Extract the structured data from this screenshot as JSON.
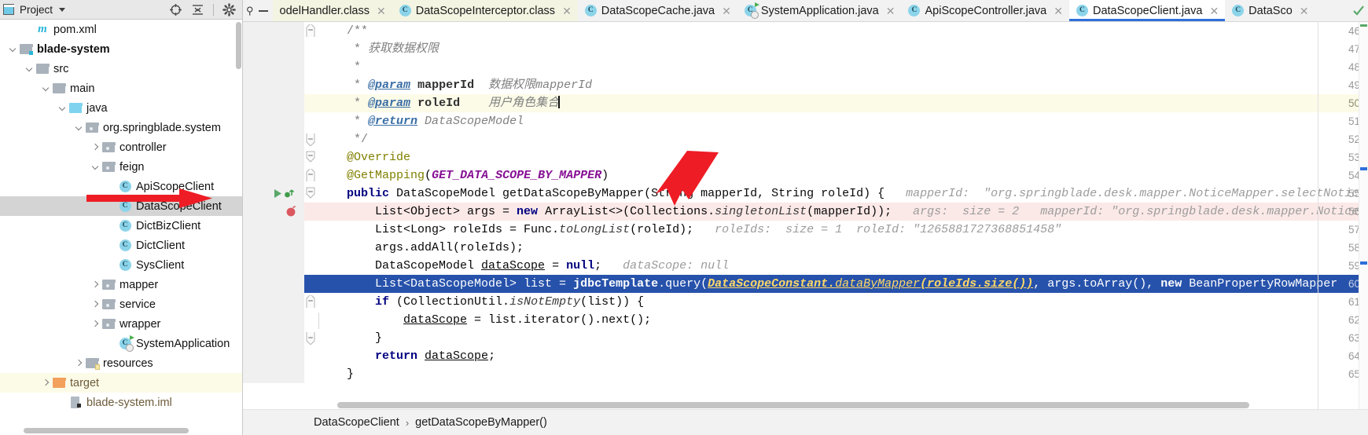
{
  "project_panel": {
    "title": "Project",
    "title_caret": "▾",
    "icons": [
      {
        "name": "locate-icon"
      },
      {
        "name": "collapse-all-icon"
      },
      {
        "name": "gear-icon"
      }
    ],
    "tree": [
      {
        "label": "pom.xml",
        "indent": 1,
        "twist": "",
        "icon": "maven-file-icon",
        "style": "plain",
        "row": "plain"
      },
      {
        "label": "blade-system",
        "indent": 0,
        "twist": "down",
        "icon": "module-folder-icon",
        "style": "bold",
        "row": "plain"
      },
      {
        "label": "src",
        "indent": 1,
        "twist": "down",
        "icon": "folder-icon",
        "style": "plain",
        "row": "plain"
      },
      {
        "label": "main",
        "indent": 2,
        "twist": "down",
        "icon": "folder-icon",
        "style": "plain",
        "row": "plain"
      },
      {
        "label": "java",
        "indent": 3,
        "twist": "down",
        "icon": "source-root-icon",
        "style": "plain",
        "row": "plain"
      },
      {
        "label": "org.springblade.system",
        "indent": 4,
        "twist": "down",
        "icon": "package-icon",
        "style": "plain",
        "row": "plain"
      },
      {
        "label": "controller",
        "indent": 5,
        "twist": "right",
        "icon": "package-icon",
        "style": "plain",
        "row": "plain"
      },
      {
        "label": "feign",
        "indent": 5,
        "twist": "down",
        "icon": "package-icon",
        "style": "plain",
        "row": "plain"
      },
      {
        "label": "ApiScopeClient",
        "indent": 6,
        "twist": "",
        "icon": "java-class-icon",
        "style": "plain",
        "row": "plain"
      },
      {
        "label": "DataScopeClient",
        "indent": 6,
        "twist": "",
        "icon": "java-class-icon",
        "style": "plain",
        "row": "selected"
      },
      {
        "label": "DictBizClient",
        "indent": 6,
        "twist": "",
        "icon": "java-class-icon",
        "style": "plain",
        "row": "plain"
      },
      {
        "label": "DictClient",
        "indent": 6,
        "twist": "",
        "icon": "java-class-icon",
        "style": "plain",
        "row": "plain"
      },
      {
        "label": "SysClient",
        "indent": 6,
        "twist": "",
        "icon": "java-class-icon",
        "style": "plain",
        "row": "plain"
      },
      {
        "label": "mapper",
        "indent": 5,
        "twist": "right",
        "icon": "package-icon",
        "style": "plain",
        "row": "plain"
      },
      {
        "label": "service",
        "indent": 5,
        "twist": "right",
        "icon": "package-icon",
        "style": "plain",
        "row": "plain"
      },
      {
        "label": "wrapper",
        "indent": 5,
        "twist": "right",
        "icon": "package-icon",
        "style": "plain",
        "row": "plain"
      },
      {
        "label": "SystemApplication",
        "indent": 6,
        "twist": "",
        "icon": "spring-boot-class-icon",
        "style": "plain",
        "row": "plain"
      },
      {
        "label": "resources",
        "indent": 4,
        "twist": "right",
        "icon": "resources-folder-icon",
        "style": "plain",
        "row": "plain"
      },
      {
        "label": "target",
        "indent": 2,
        "twist": "right",
        "icon": "target-folder-icon",
        "style": "brown",
        "row": "yellow"
      },
      {
        "label": "blade-system.iml",
        "indent": 3,
        "twist": "",
        "icon": "iml-file-icon",
        "style": "brown",
        "row": "plain"
      }
    ]
  },
  "editor_tabs": {
    "leading": {
      "pin_icon": "pin-icon",
      "dash_icon": "minimize-icon"
    },
    "tabs": [
      {
        "label": "odelHandler.class",
        "icon": "",
        "yellowed": true,
        "active": false,
        "clipped": true
      },
      {
        "label": "DataScopeInterceptor.class",
        "icon": "java-class-icon",
        "yellowed": true,
        "active": false,
        "clipped": false
      },
      {
        "label": "DataScopeCache.java",
        "icon": "java-class-icon",
        "yellowed": false,
        "active": false,
        "clipped": false
      },
      {
        "label": "SystemApplication.java",
        "icon": "spring-boot-class-icon",
        "yellowed": false,
        "active": false,
        "clipped": false
      },
      {
        "label": "ApiScopeController.java",
        "icon": "java-class-icon",
        "yellowed": false,
        "active": false,
        "clipped": false
      },
      {
        "label": "DataScopeClient.java",
        "icon": "java-class-icon",
        "yellowed": false,
        "active": true,
        "clipped": false
      },
      {
        "label": "DataSco",
        "icon": "java-class-icon",
        "yellowed": false,
        "active": false,
        "clipped": true
      }
    ],
    "close_glyph": "✕"
  },
  "code": {
    "first_line_number": 46,
    "lines": [
      {
        "num": "46",
        "row": "plain",
        "fold": "fold-end-top",
        "indent": 4,
        "tokens": [
          {
            "t": "/**",
            "c": "c-cmt-b"
          }
        ]
      },
      {
        "num": "47",
        "row": "plain",
        "fold": "",
        "indent": 5,
        "tokens": [
          {
            "t": "* ",
            "c": "c-cmt-b"
          },
          {
            "t": "获取数据权限",
            "c": "c-cmt"
          }
        ]
      },
      {
        "num": "48",
        "row": "plain",
        "fold": "",
        "indent": 5,
        "tokens": [
          {
            "t": "*",
            "c": "c-cmt-b"
          }
        ]
      },
      {
        "num": "49",
        "row": "plain",
        "fold": "",
        "indent": 5,
        "tokens": [
          {
            "t": "* ",
            "c": "c-cmt-b"
          },
          {
            "t": "@param",
            "c": "c-tag"
          },
          {
            "t": " ",
            "c": "c-cmt-b"
          },
          {
            "t": "mapperId",
            "c": "c-tagparam"
          },
          {
            "t": "  数据权限mapperId",
            "c": "c-cmt"
          }
        ]
      },
      {
        "num": "50",
        "row": "yellow",
        "fold": "",
        "indent": 5,
        "tokens": [
          {
            "t": "* ",
            "c": "c-cmt-b"
          },
          {
            "t": "@param",
            "c": "c-tag"
          },
          {
            "t": " ",
            "c": "c-cmt-b"
          },
          {
            "t": "roleId",
            "c": "c-tagparam"
          },
          {
            "t": "    用户角色集合",
            "c": "c-cmt"
          },
          {
            "t": "|caret|",
            "c": "caret"
          }
        ]
      },
      {
        "num": "51",
        "row": "plain",
        "fold": "",
        "indent": 5,
        "tokens": [
          {
            "t": "* ",
            "c": "c-cmt-b"
          },
          {
            "t": "@return",
            "c": "c-tag"
          },
          {
            "t": " DataScopeModel",
            "c": "c-cmt"
          }
        ]
      },
      {
        "num": "52",
        "row": "plain",
        "fold": "fold-end-bot",
        "indent": 5,
        "tokens": [
          {
            "t": "*/",
            "c": "c-cmt-b"
          }
        ]
      },
      {
        "num": "53",
        "row": "plain",
        "fold": "fold-collapse",
        "indent": 4,
        "tokens": [
          {
            "t": "@Override",
            "c": "c-anno"
          }
        ]
      },
      {
        "num": "54",
        "row": "plain",
        "fold": "fold-end-top",
        "indent": 4,
        "tokens": [
          {
            "t": "@GetMapping",
            "c": "c-anno"
          },
          {
            "t": "(",
            "c": "c-plain"
          },
          {
            "t": "GET_DATA_SCOPE_BY_MAPPER",
            "c": "c-const"
          },
          {
            "t": ")",
            "c": "c-plain"
          }
        ]
      },
      {
        "num": "55",
        "row": "plain",
        "fold": "fold-collapse",
        "indent": 4,
        "marker": "run-marker",
        "tokens": [
          {
            "t": "public",
            "c": "c-kw"
          },
          {
            "t": " DataScopeModel getDataScopeByMapper(String mapperId, String roleId) {",
            "c": "c-plain"
          },
          {
            "t": "   mapperId:  \"org.springblade.desk.mapper.NoticeMapper.selectNotic",
            "c": "c-hint"
          }
        ]
      },
      {
        "num": "56",
        "row": "pink",
        "fold": "",
        "indent": 8,
        "marker": "bp-marker",
        "tokens": [
          {
            "t": "List<Object> args = ",
            "c": "c-plain"
          },
          {
            "t": "new",
            "c": "c-kw"
          },
          {
            "t": " ArrayList<>(Collections.",
            "c": "c-plain"
          },
          {
            "t": "singletonList",
            "c": "c-static"
          },
          {
            "t": "(mapperId));",
            "c": "c-plain"
          },
          {
            "t": "   args:  size = 2   mapperId: \"org.springblade.desk.mapper.Notice",
            "c": "c-hint"
          }
        ]
      },
      {
        "num": "57",
        "row": "plain",
        "fold": "",
        "indent": 8,
        "tokens": [
          {
            "t": "List<Long> roleIds = Func.",
            "c": "c-plain"
          },
          {
            "t": "toLongList",
            "c": "c-static"
          },
          {
            "t": "(roleId);",
            "c": "c-plain"
          },
          {
            "t": "   roleIds:  size = 1  roleId: \"1265881727368851458\"",
            "c": "c-hint"
          }
        ]
      },
      {
        "num": "58",
        "row": "plain",
        "fold": "",
        "indent": 8,
        "tokens": [
          {
            "t": "args.addAll(roleIds);",
            "c": "c-plain"
          }
        ]
      },
      {
        "num": "59",
        "row": "plain",
        "fold": "",
        "indent": 8,
        "tokens": [
          {
            "t": "DataScopeModel ",
            "c": "c-plain"
          },
          {
            "t": "dataScope",
            "c": "c-local-u"
          },
          {
            "t": " = ",
            "c": "c-plain"
          },
          {
            "t": "null",
            "c": "c-kw"
          },
          {
            "t": ";",
            "c": "c-plain"
          },
          {
            "t": "   dataScope: null",
            "c": "c-hint"
          }
        ]
      },
      {
        "num": "60",
        "row": "blue",
        "fold": "",
        "indent": 8,
        "tokens": [
          {
            "t": "List<DataScopeModel> list = ",
            "c": "c-plain"
          },
          {
            "t": "jdbcTemplate",
            "c": "c-field"
          },
          {
            "t": ".query(",
            "c": "c-plain"
          },
          {
            "t": "DataScopeConstant.",
            "c": "c-const u-line"
          },
          {
            "t": "dataByMapper",
            "c": "c-static u-line"
          },
          {
            "t": "(roleIds.size())",
            "c": "c-const u-line"
          },
          {
            "t": ", args.toArray(), ",
            "c": "c-plain"
          },
          {
            "t": "new",
            "c": "c-kw"
          },
          {
            "t": " BeanPropertyRowMapper",
            "c": "c-plain"
          }
        ]
      },
      {
        "num": "61",
        "row": "plain",
        "fold": "fold-end-top",
        "indent": 8,
        "tokens": [
          {
            "t": "if",
            "c": "c-kw"
          },
          {
            "t": " (CollectionUtil.",
            "c": "c-plain"
          },
          {
            "t": "isNotEmpty",
            "c": "c-static"
          },
          {
            "t": "(list)) {",
            "c": "c-plain"
          }
        ]
      },
      {
        "num": "62",
        "row": "plain",
        "fold": "",
        "indent": 12,
        "tokens": [
          {
            "t": "dataScope",
            "c": "c-local-u"
          },
          {
            "t": " = list.iterator().next();",
            "c": "c-plain"
          }
        ]
      },
      {
        "num": "63",
        "row": "plain",
        "fold": "fold-end-bot",
        "indent": 8,
        "tokens": [
          {
            "t": "}",
            "c": "c-plain"
          }
        ]
      },
      {
        "num": "64",
        "row": "plain",
        "fold": "",
        "indent": 8,
        "tokens": [
          {
            "t": "return",
            "c": "c-kw"
          },
          {
            "t": " ",
            "c": "c-plain"
          },
          {
            "t": "dataScope",
            "c": "c-local-u"
          },
          {
            "t": ";",
            "c": "c-plain"
          }
        ]
      },
      {
        "num": "65",
        "row": "plain",
        "fold": "",
        "indent": 4,
        "tokens": [
          {
            "t": "}",
            "c": "c-plain"
          }
        ]
      }
    ]
  },
  "breadcrumb": {
    "items": [
      "DataScopeClient",
      "getDataScopeByMapper()"
    ],
    "separator": "›"
  },
  "annotations": {
    "arrow_tree_target": "DataScopeClient",
    "arrow_code_target": "mapperId parameter"
  },
  "colors": {
    "accent_tab_underline": "#2e6fd9",
    "selection_blue": "#2752ab",
    "caret_line_yellow": "#fcfbe8",
    "exec_line_pink": "#fbe9e7",
    "tree_selection": "#d4d4d4",
    "annotation_red": "#ee1c25",
    "hint_gray": "#9c9c9c",
    "keyword_navy": "#000080",
    "annotation_olive": "#808000",
    "constant_purple": "#871094",
    "string_green": "#067d17"
  }
}
